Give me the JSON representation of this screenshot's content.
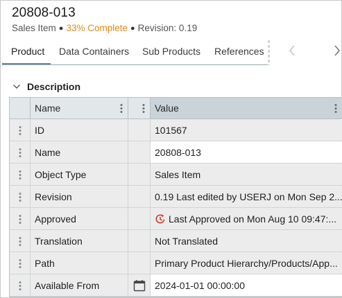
{
  "header": {
    "title": "20808-013",
    "item_type": "Sales Item",
    "completion": "33% Complete",
    "revision": "Revision: 0.19"
  },
  "tabs": [
    {
      "label": "Product",
      "active": true
    },
    {
      "label": "Data Containers",
      "active": false
    },
    {
      "label": "Sub Products",
      "active": false
    },
    {
      "label": "References",
      "active": false
    }
  ],
  "section": {
    "label": "Description"
  },
  "grid": {
    "columns": {
      "name": "Name",
      "value": "Value"
    },
    "rows": [
      {
        "name": "ID",
        "value": "101567"
      },
      {
        "name": "Name",
        "value": "20808-013"
      },
      {
        "name": "Object Type",
        "value": "Sales Item"
      },
      {
        "name": "Revision",
        "value": "0.19 Last edited by USERJ on Mon Sep 2..."
      },
      {
        "name": "Approved",
        "value": "Last Approved on Mon Aug 10 09:47:..."
      },
      {
        "name": "Translation",
        "value": "Not Translated"
      },
      {
        "name": "Path",
        "value": "Primary Product Hierarchy/Products/App..."
      },
      {
        "name": "Available From",
        "value": "2024-01-01 00:00:00"
      }
    ]
  },
  "colors": {
    "accent": "#e08a1e",
    "tab_underline": "#6c8a94",
    "header_bg": "#e2e7ea",
    "value_header_bg": "#c9d3d8",
    "approved_icon": "#d9302b"
  }
}
